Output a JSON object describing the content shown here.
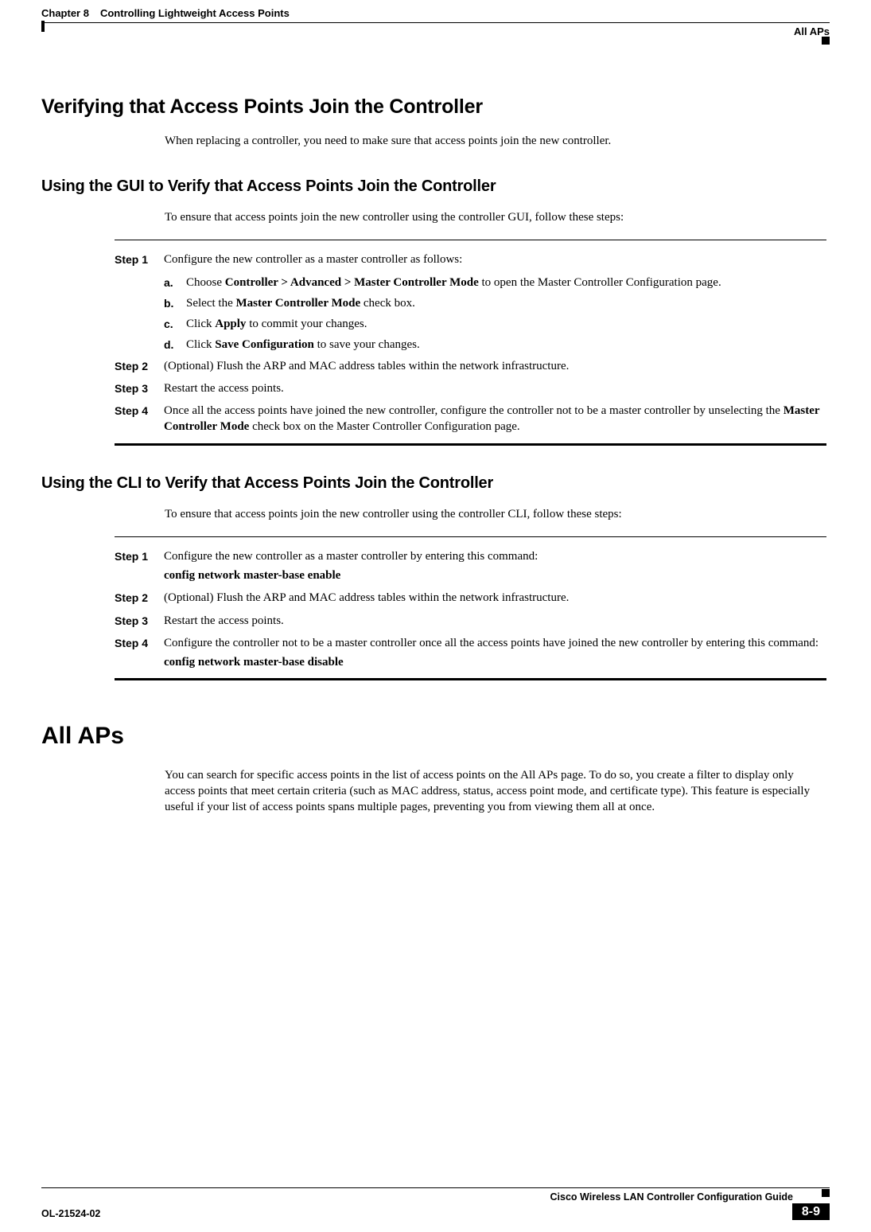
{
  "header": {
    "chapter_label": "Chapter 8",
    "chapter_title": "Controlling Lightweight Access Points",
    "side_title": "All APs"
  },
  "section1": {
    "title": "Verifying that Access Points Join the Controller",
    "intro": "When replacing a controller, you need to make sure that access points join the new controller."
  },
  "gui": {
    "title": "Using the GUI to Verify that Access Points Join the Controller",
    "intro": "To ensure that access points join the new controller using the controller GUI, follow these steps:",
    "steps": {
      "s1": {
        "label": "Step 1",
        "text": "Configure the new controller as a master controller as follows:"
      },
      "s2": {
        "label": "Step 2",
        "text": "(Optional) Flush the ARP and MAC address tables within the network infrastructure."
      },
      "s3": {
        "label": "Step 3",
        "text": "Restart the access points."
      },
      "s4": {
        "label": "Step 4",
        "text_a": "Once all the access points have joined the new controller, configure the controller not to be a master controller by unselecting the ",
        "text_bold": "Master Controller Mode",
        "text_b": " check box on the Master Controller Configuration page."
      }
    },
    "subs": {
      "a": {
        "label": "a.",
        "pre": "Choose ",
        "bold1": "Controller > Advanced > Master Controller Mode",
        "post": " to open the Master Controller Configuration page."
      },
      "b": {
        "label": "b.",
        "pre": "Select the ",
        "bold1": "Master Controller Mode",
        "post": " check box."
      },
      "c": {
        "label": "c.",
        "pre": "Click ",
        "bold1": "Apply",
        "post": " to commit your changes."
      },
      "d": {
        "label": "d.",
        "pre": "Click ",
        "bold1": "Save Configuration",
        "post": " to save your changes."
      }
    }
  },
  "cli": {
    "title": "Using the CLI to Verify that Access Points Join the Controller",
    "intro": "To ensure that access points join the new controller using the controller CLI, follow these steps:",
    "steps": {
      "s1": {
        "label": "Step 1",
        "text": "Configure the new controller as a master controller by entering this command:",
        "cmd": "config network master-base enable"
      },
      "s2": {
        "label": "Step 2",
        "text": "(Optional) Flush the ARP and MAC address tables within the network infrastructure."
      },
      "s3": {
        "label": "Step 3",
        "text": "Restart the access points."
      },
      "s4": {
        "label": "Step 4",
        "text": "Configure the controller not to be a master controller once all the access points have joined the new controller by entering this command:",
        "cmd": "config network master-base disable"
      }
    }
  },
  "allaps": {
    "title": "All APs",
    "para": "You can search for specific access points in the list of access points on the All APs page. To do so, you create a filter to display only access points that meet certain criteria (such as MAC address, status, access point mode, and certificate type). This feature is especially useful if your list of access points spans multiple pages, preventing you from viewing them all at once."
  },
  "footer": {
    "guide": "Cisco Wireless LAN Controller Configuration Guide",
    "docnum": "OL-21524-02",
    "page": "8-9"
  }
}
